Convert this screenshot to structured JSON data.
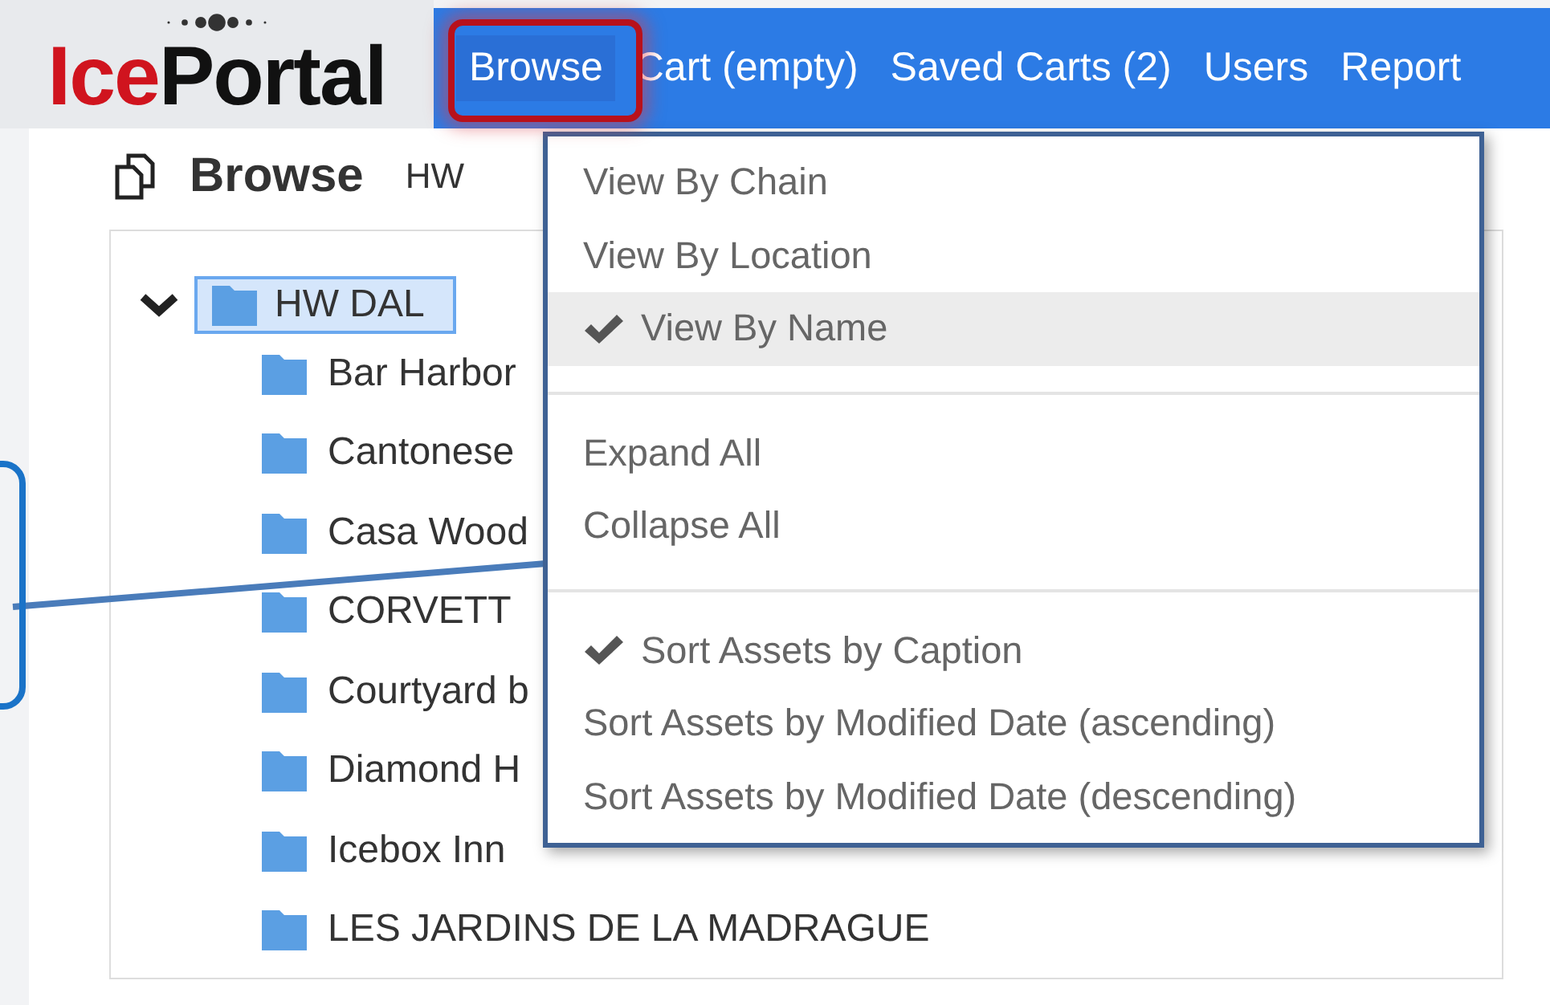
{
  "logo": {
    "text_1": "Ice",
    "text_2": "Portal"
  },
  "nav": [
    {
      "label": "Browse",
      "selected": true
    },
    {
      "label": "Cart (empty)",
      "selected": false
    },
    {
      "label": "Saved Carts (2)",
      "selected": false
    },
    {
      "label": "Users",
      "selected": false
    },
    {
      "label": "Report",
      "selected": false
    }
  ],
  "page": {
    "title": "Browse",
    "breadcrumb": "HW"
  },
  "tree": {
    "label": "HW DAL",
    "expanded": true,
    "selected": true,
    "children": [
      {
        "label": "Bar Harbor"
      },
      {
        "label": "Cantonese"
      },
      {
        "label": "Casa Wood"
      },
      {
        "label": "CORVETT"
      },
      {
        "label": "Courtyard b"
      },
      {
        "label": "Diamond H"
      },
      {
        "label": "Icebox Inn"
      },
      {
        "label": "LES JARDINS DE LA MADRAGUE"
      }
    ]
  },
  "menu": {
    "groups": [
      [
        {
          "label": "View By Chain",
          "checked": false,
          "highlighted": false
        },
        {
          "label": "View By Location",
          "checked": false,
          "highlighted": false
        },
        {
          "label": "View By Name",
          "checked": true,
          "highlighted": true
        }
      ],
      [
        {
          "label": "Expand All",
          "checked": false,
          "highlighted": false
        },
        {
          "label": "Collapse All",
          "checked": false,
          "highlighted": false
        }
      ],
      [
        {
          "label": "Sort Assets by Caption",
          "checked": true,
          "highlighted": false
        },
        {
          "label": "Sort Assets by Modified Date (ascending)",
          "checked": false,
          "highlighted": false
        },
        {
          "label": "Sort Assets by Modified Date (descending)",
          "checked": false,
          "highlighted": false
        }
      ]
    ]
  }
}
